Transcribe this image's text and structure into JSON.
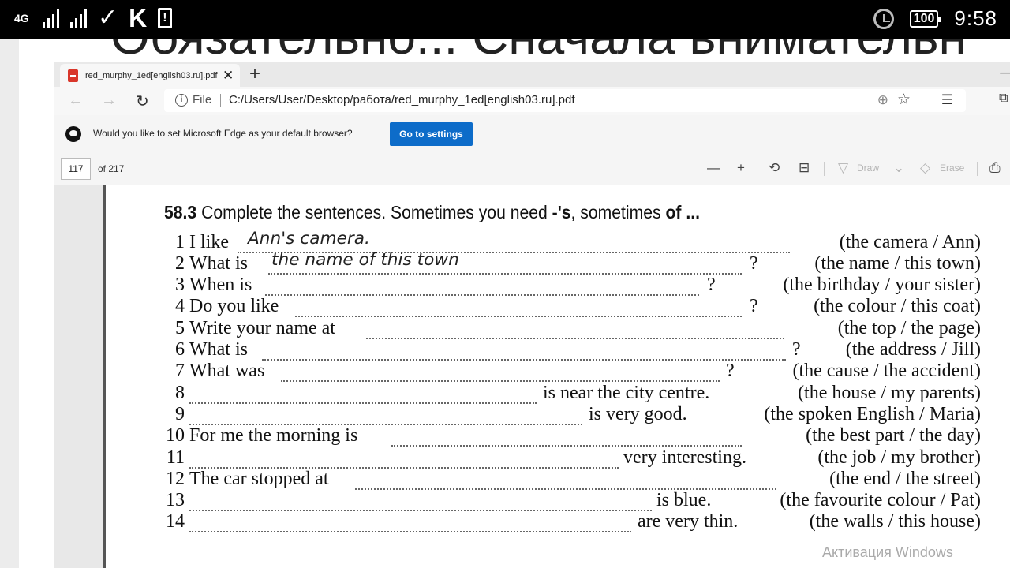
{
  "status_bar": {
    "network": "4G",
    "battery": "100",
    "time": "9:58"
  },
  "background_text": "Обязательно... Сначала внимательн",
  "browser": {
    "tab_title": "red_murphy_1ed[english03.ru].pdf",
    "url_scheme_label": "File",
    "url": "C:/Users/User/Desktop/работа/red_murphy_1ed[english03.ru].pdf"
  },
  "infobar": {
    "message": "Would you like to set Microsoft Edge as your default browser?",
    "button": "Go to settings"
  },
  "pdf_toolbar": {
    "page": "117",
    "of_pages": "of 217",
    "draw_label": "Draw",
    "erase_label": "Erase"
  },
  "exercise": {
    "number": "58.3",
    "instruction": "Complete the sentences. Sometimes you need ",
    "apostrophe": "-'s",
    "instruction_mid": ", sometimes ",
    "of_word": "of ...",
    "items": [
      {
        "n": "1",
        "text": "I like",
        "answer": "Ann's camera.",
        "after": "",
        "hint": "(the camera / Ann)"
      },
      {
        "n": "2",
        "text": "What is",
        "answer": "the name of this town",
        "after": "?",
        "hint": "(the name / this town)"
      },
      {
        "n": "3",
        "text": "When is",
        "answer": "",
        "after": "?",
        "hint": "(the birthday / your sister)"
      },
      {
        "n": "4",
        "text": "Do you like",
        "answer": "",
        "after": "?",
        "hint": "(the colour / this coat)"
      },
      {
        "n": "5",
        "text": "Write your name at",
        "answer": "",
        "after": "",
        "hint": "(the top / the page)"
      },
      {
        "n": "6",
        "text": "What is",
        "answer": "",
        "after": "?",
        "hint": "(the address / Jill)"
      },
      {
        "n": "7",
        "text": "What was",
        "answer": "",
        "after": "?",
        "hint": "(the cause / the accident)"
      },
      {
        "n": "8",
        "text": "",
        "answer": "",
        "after": "is near the city centre.",
        "hint": "(the house / my parents)"
      },
      {
        "n": "9",
        "text": "",
        "answer": "",
        "after": "is very good.",
        "hint": "(the spoken English / Maria)"
      },
      {
        "n": "10",
        "text": "For me the morning is",
        "answer": "",
        "after": "",
        "hint": "(the best part / the day)"
      },
      {
        "n": "11",
        "text": "",
        "answer": "",
        "after": "very interesting.",
        "hint": "(the job / my brother)"
      },
      {
        "n": "12",
        "text": "The car stopped at",
        "answer": "",
        "after": "",
        "hint": "(the end / the street)"
      },
      {
        "n": "13",
        "text": "",
        "answer": "",
        "after": "is blue.",
        "hint": "(the favourite colour / Pat)"
      },
      {
        "n": "14",
        "text": "",
        "answer": "",
        "after": "are very thin.",
        "hint": "(the walls / this house)"
      }
    ]
  },
  "watermark": "Активация Windows",
  "colors": {
    "accent": "#0d6cc9",
    "pdf_icon": "#d9372b"
  }
}
